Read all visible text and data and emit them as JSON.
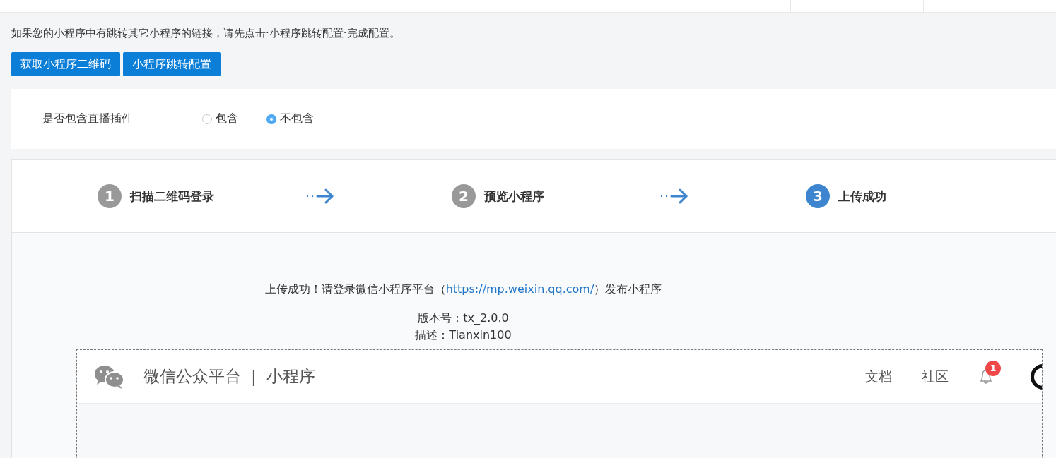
{
  "notice": "如果您的小程序中有跳转其它小程序的链接，请先点击·小程序跳转配置·完成配置。",
  "buttons": [
    "获取小程序二维码",
    "小程序跳转配置"
  ],
  "plugin_option": {
    "label": "是否包含直播插件",
    "options": [
      {
        "label": "包含",
        "selected": false
      },
      {
        "label": "不包含",
        "selected": true
      }
    ]
  },
  "steps": [
    {
      "number": "1",
      "label": "扫描二维码登录",
      "selected": false
    },
    {
      "number": "2",
      "label": "预览小程序",
      "selected": false
    },
    {
      "number": "3",
      "label": "上传成功",
      "selected": true
    }
  ],
  "result": {
    "message_before": "上传成功！请登录微信小程序平台（",
    "link": "https://mp.weixin.qq.com/",
    "message_after": "）发布小程序",
    "version": "版本号：tx_2.0.0",
    "description": "描述：Tianxin100"
  },
  "embedded_screenshot": {
    "brand": "微信公众平台",
    "separator": "|",
    "product": "小程序",
    "nav": [
      "文档",
      "社区"
    ],
    "notification_count": "1"
  }
}
